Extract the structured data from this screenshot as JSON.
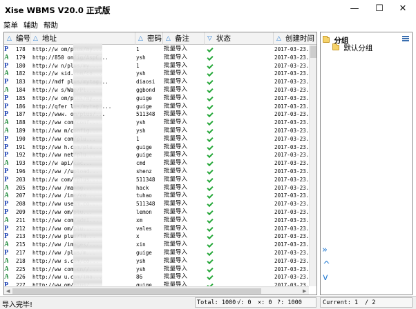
{
  "window": {
    "title": "Xise WBMS V20.0 正式版",
    "controls": {
      "minimize": "—",
      "maximize": "☐",
      "close": "✕"
    }
  },
  "menu": [
    "菜单",
    "辅助",
    "帮助"
  ],
  "grid": {
    "columns": [
      "编号",
      "地址",
      "密码",
      "备注",
      "状态",
      "创建时间"
    ],
    "rows": [
      {
        "type": "P",
        "num": "178",
        "url": "http://w          om/plus/my...",
        "pwd": "1",
        "note": "批量导入",
        "date": "2017-03-23..."
      },
      {
        "type": "A",
        "num": "179",
        "url": "http://850         onfig/AspC...",
        "pwd": "ysh",
        "note": "批量导入",
        "date": "2017-03-23..."
      },
      {
        "type": "P",
        "num": "180",
        "url": "http://w           n/plus/my...",
        "pwd": "1",
        "note": "批量导入",
        "date": "2017-03-23..."
      },
      {
        "type": "A",
        "num": "182",
        "url": "http://w          sid.com/co...",
        "pwd": "ysh",
        "note": "批量导入",
        "date": "2017-03-23..."
      },
      {
        "type": "P",
        "num": "183",
        "url": "http://mdf       plus/mytag...",
        "pwd": "diaosi",
        "note": "批量导入",
        "date": "2017-03-23..."
      },
      {
        "type": "A",
        "num": "184",
        "url": "http://w           s/Wap/Pl...",
        "pwd": "ggbond",
        "note": "批量导入",
        "date": "2017-03-23..."
      },
      {
        "type": "P",
        "num": "185",
        "url": "http://w          om/plus/my...",
        "pwd": "guige",
        "note": "批量导入",
        "date": "2017-03-23..."
      },
      {
        "type": "P",
        "num": "186",
        "url": "http://qfer       lus/mytag_...",
        "pwd": "guige",
        "note": "批量导入",
        "date": "2017-03-23..."
      },
      {
        "type": "P",
        "num": "187",
        "url": "http://www.         om/plus/...",
        "pwd": "511348",
        "note": "批量导入",
        "date": "2017-03-23..."
      },
      {
        "type": "A",
        "num": "188",
        "url": "http://ww          com/conf...",
        "pwd": "ysh",
        "note": "批量导入",
        "date": "2017-03-23..."
      },
      {
        "type": "A",
        "num": "189",
        "url": "http://ww          m/config...",
        "pwd": "ysh",
        "note": "批量导入",
        "date": "2017-03-23..."
      },
      {
        "type": "P",
        "num": "190",
        "url": "http://ww          com/plu...",
        "pwd": "1",
        "note": "批量导入",
        "date": "2017-03-23..."
      },
      {
        "type": "P",
        "num": "191",
        "url": "http://ww          h.com/plu...",
        "pwd": "guige",
        "note": "批量导入",
        "date": "2017-03-23..."
      },
      {
        "type": "P2",
        "num": "192",
        "url": "http://ww         net/plu...",
        "pwd": "guige",
        "note": "批量导入",
        "date": "2017-03-23..."
      },
      {
        "type": "A",
        "num": "193",
        "url": "http://w          api/cac...",
        "pwd": "cmd",
        "note": "批量导入",
        "date": "2017-03-23..."
      },
      {
        "type": "P",
        "num": "196",
        "url": "http://ww         //upload...",
        "pwd": "shenz",
        "note": "批量导入",
        "date": "2017-03-23..."
      },
      {
        "type": "P",
        "num": "203",
        "url": "http://w          com//plus...",
        "pwd": "511348",
        "note": "批量导入",
        "date": "2017-03-23..."
      },
      {
        "type": "A",
        "num": "205",
        "url": "http://ww          /manag...",
        "pwd": "hack",
        "note": "批量导入",
        "date": "2017-03-23..."
      },
      {
        "type": "A",
        "num": "207",
        "url": "http://ww          /inc/co...",
        "pwd": "tuhao",
        "note": "批量导入",
        "date": "2017-03-23..."
      },
      {
        "type": "P",
        "num": "208",
        "url": "http://ww          useum.co...",
        "pwd": "511348",
        "note": "批量导入",
        "date": "2017-03-23..."
      },
      {
        "type": "P",
        "num": "209",
        "url": "http://ww          om/plu...",
        "pwd": "lemon",
        "note": "批量导入",
        "date": "2017-03-23..."
      },
      {
        "type": "A",
        "num": "211",
        "url": "http://ww          com/admi...",
        "pwd": "xm",
        "note": "批量导入",
        "date": "2017-03-23..."
      },
      {
        "type": "P2",
        "num": "212",
        "url": "http://ww         om/plu...",
        "pwd": "vales",
        "note": "批量导入",
        "date": "2017-03-23..."
      },
      {
        "type": "P",
        "num": "213",
        "url": "http://ww          plus/la...",
        "pwd": "x",
        "note": "批量导入",
        "date": "2017-03-23..."
      },
      {
        "type": "A",
        "num": "215",
        "url": "http://ww          /images/...",
        "pwd": "xin",
        "note": "批量导入",
        "date": "2017-03-23..."
      },
      {
        "type": "P",
        "num": "217",
        "url": "http://ww          /plus/m...",
        "pwd": "guige",
        "note": "批量导入",
        "date": "2017-03-23..."
      },
      {
        "type": "A",
        "num": "218",
        "url": "http://ww          s.com/co...",
        "pwd": "ysh",
        "note": "批量导入",
        "date": "2017-03-23..."
      },
      {
        "type": "A",
        "num": "225",
        "url": "http://ww          com.cn//...",
        "pwd": "ysh",
        "note": "批量导入",
        "date": "2017-03-23..."
      },
      {
        "type": "A",
        "num": "226",
        "url": "http://ww          u.com/ima...",
        "pwd": "86",
        "note": "批量导入",
        "date": "2017-03-23..."
      },
      {
        "type": "P",
        "num": "227",
        "url": "http://ww          om/plus/...",
        "pwd": "guige",
        "note": "批量导入",
        "date": "2017-03-23..."
      }
    ]
  },
  "sidebar": {
    "root": "分组",
    "child": "默认分组",
    "controls": [
      "»",
      "^",
      "v"
    ]
  },
  "status": {
    "message": "导入完毕!",
    "total": "Total: 1000",
    "ok": "√: 0",
    "fail": "×: 0",
    "unknown": "?: 1000",
    "current": "Current: 1",
    "page_sep": "/ 2"
  },
  "colors": {
    "header_icon": "#2a7fd4",
    "check": "#27a83a",
    "type_P": "#1a3fb3",
    "type_A": "#1f8a3a"
  }
}
